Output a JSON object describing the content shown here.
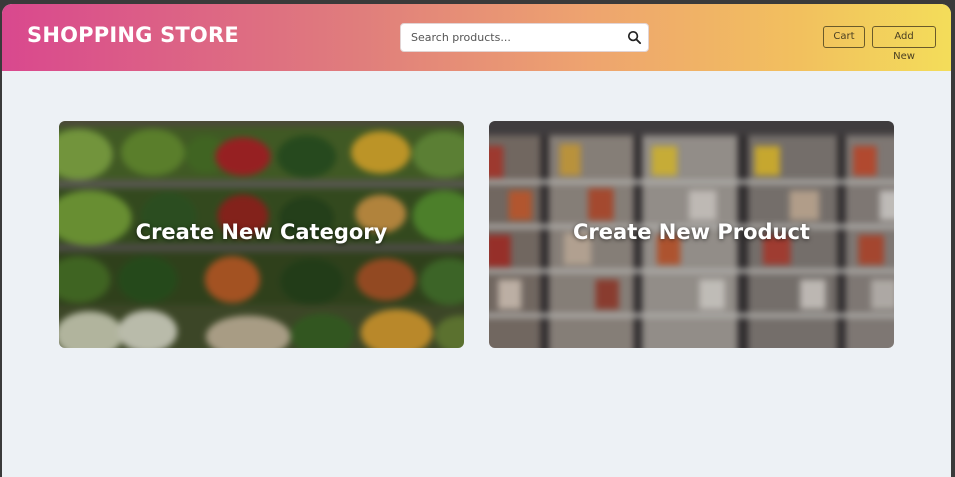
{
  "navbar": {
    "brand": "SHOPPING STORE",
    "search": {
      "placeholder": "Search products...",
      "icon": "search-icon"
    },
    "cart_label": "Cart",
    "add_new_label": "Add New"
  },
  "cards": [
    {
      "title": "Create New Category",
      "image": "produce-shelves-photo"
    },
    {
      "title": "Create New Product",
      "image": "store-freezer-aisle-photo"
    }
  ],
  "colors": {
    "gradient_start": "#d9488e",
    "gradient_end": "#f3dd5a",
    "page_background": "#edf1f5"
  }
}
